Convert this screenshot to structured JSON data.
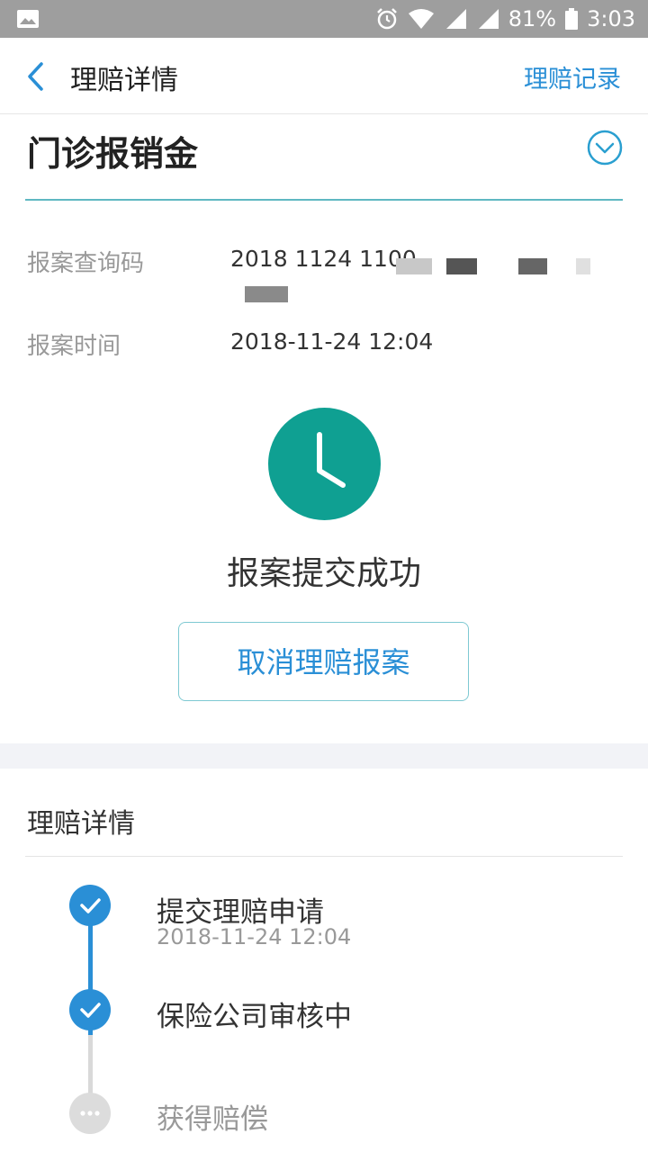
{
  "status_bar": {
    "battery": "81%",
    "time": "3:03"
  },
  "nav": {
    "title": "理赔详情",
    "right_link": "理赔记录"
  },
  "product": {
    "title": "门诊报销金"
  },
  "info": [
    {
      "label": "报案查询码",
      "value": "2018 1124 1100"
    },
    {
      "label": "报案时间",
      "value": "2018-11-24 12:04"
    }
  ],
  "status": {
    "text": "报案提交成功",
    "icon": "clock-icon"
  },
  "cancel_button": {
    "label": "取消理赔报案"
  },
  "detail": {
    "title": "理赔详情",
    "steps": [
      {
        "title": "提交理赔申请",
        "time": "2018-11-24 12:04",
        "state": "done"
      },
      {
        "title": "保险公司审核中",
        "time": "",
        "state": "done"
      },
      {
        "title": "获得赔偿",
        "time": "",
        "state": "pending"
      }
    ]
  },
  "colors": {
    "accent": "#2a8fd6",
    "teal": "#0fa092",
    "divider": "#5fb8c2",
    "pending": "#d9d9d9"
  }
}
